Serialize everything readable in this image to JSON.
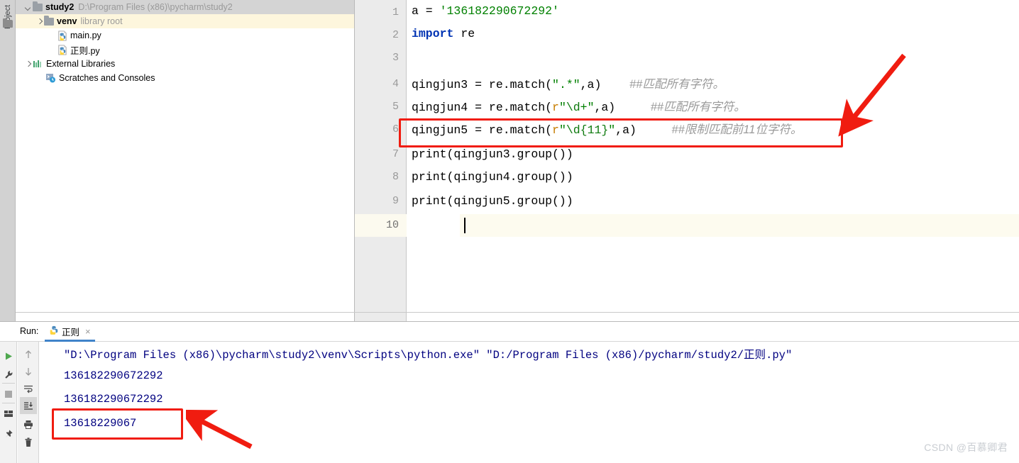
{
  "window": {
    "tool_strip_label": "Project",
    "tool_strip_icon": "folder-icon"
  },
  "project_tree": {
    "items": [
      {
        "name": "study2",
        "detail": "D:\\Program Files (x86)\\pycharm\\study2",
        "icon": "folder-icon",
        "arrow": "chevron-down-icon",
        "indent": 12,
        "state": "selected-grey",
        "bold": true
      },
      {
        "name": "venv",
        "detail": "library root",
        "icon": "folder-icon",
        "arrow": "chevron-right-icon",
        "indent": 28,
        "state": "selected-yellow",
        "bold": true
      },
      {
        "name": "main.py",
        "detail": "",
        "icon": "python-file-icon",
        "arrow": "none",
        "indent": 46,
        "state": "none",
        "bold": false
      },
      {
        "name": "正则.py",
        "detail": "",
        "icon": "python-file-icon",
        "arrow": "none",
        "indent": 46,
        "state": "none",
        "bold": false
      },
      {
        "name": "External Libraries",
        "detail": "",
        "icon": "library-icon",
        "arrow": "chevron-right-icon",
        "indent": 12,
        "state": "none",
        "bold": false
      },
      {
        "name": "Scratches and Consoles",
        "detail": "",
        "icon": "scratches-icon",
        "arrow": "none",
        "indent": 28,
        "state": "none",
        "bold": false
      }
    ]
  },
  "editor": {
    "line_numbers": [
      "1",
      "2",
      "3",
      "4",
      "5",
      "6",
      "7",
      "8",
      "9",
      "10"
    ],
    "active_line": "10",
    "lines": [
      {
        "n": "1",
        "parts": [
          {
            "t": "a = ",
            "c": "plain"
          },
          {
            "t": "'136182290672292'",
            "c": "string"
          }
        ]
      },
      {
        "n": "2",
        "parts": [
          {
            "t": "import",
            "c": "keyword"
          },
          {
            "t": " re",
            "c": "plain"
          }
        ]
      },
      {
        "n": "3",
        "parts": []
      },
      {
        "n": "4",
        "parts": [
          {
            "t": "qingjun3 = re.match(",
            "c": "plain"
          },
          {
            "t": "\".*\"",
            "c": "string"
          },
          {
            "t": ",a)",
            "c": "plain"
          },
          {
            "t": "    ",
            "c": "plain"
          },
          {
            "t": "##匹配所有字符。",
            "c": "comment"
          }
        ]
      },
      {
        "n": "5",
        "parts": [
          {
            "t": "qingjun4 = re.match(",
            "c": "plain"
          },
          {
            "t": "r",
            "c": "prefix"
          },
          {
            "t": "\"",
            "c": "string"
          },
          {
            "t": "\\d",
            "c": "escape"
          },
          {
            "t": "+\"",
            "c": "string"
          },
          {
            "t": ",a)",
            "c": "plain"
          },
          {
            "t": "     ",
            "c": "plain"
          },
          {
            "t": "##匹配所有字符。",
            "c": "comment"
          }
        ]
      },
      {
        "n": "6",
        "parts": [
          {
            "t": "qingjun5 = re.match(",
            "c": "plain"
          },
          {
            "t": "r",
            "c": "prefix"
          },
          {
            "t": "\"",
            "c": "string"
          },
          {
            "t": "\\d{11}",
            "c": "escape"
          },
          {
            "t": "\"",
            "c": "string"
          },
          {
            "t": ",a)",
            "c": "plain"
          },
          {
            "t": "     ",
            "c": "plain"
          },
          {
            "t": "##限制匹配前11位字符。",
            "c": "comment"
          }
        ]
      },
      {
        "n": "7",
        "parts": [
          {
            "t": "print(qingjun3.group())",
            "c": "plain"
          }
        ]
      },
      {
        "n": "8",
        "parts": [
          {
            "t": "print(qingjun4.group())",
            "c": "plain"
          }
        ]
      },
      {
        "n": "9",
        "parts": [
          {
            "t": "print(qingjun5.group())",
            "c": "plain"
          }
        ]
      },
      {
        "n": "10",
        "parts": []
      }
    ],
    "code_plain": {
      "l1": "a = '136182290672292'",
      "l2": "import re",
      "l4": "qingjun3 = re.match(\".*\",a)    ##匹配所有字符。",
      "l5": "qingjun4 = re.match(r\"\\d+\",a)     ##匹配所有字符。",
      "l6": "qingjun5 = re.match(r\"\\d{11}\",a)     ##限制匹配前11位字符。",
      "l7": "print(qingjun3.group())",
      "l8": "print(qingjun4.group())",
      "l9": "print(qingjun5.group())"
    },
    "annotation": {
      "highlight_line": "6",
      "arrow": "red-arrow-pointing-down-left"
    }
  },
  "run_panel": {
    "label": "Run:",
    "tab": {
      "name": "正则",
      "icon": "python-icon",
      "close": "×"
    },
    "left_buttons": [
      {
        "name": "rerun-button",
        "icon": "play-icon"
      },
      {
        "name": "settings-button",
        "icon": "wrench-icon"
      },
      {
        "name": "stop-button",
        "icon": "stop-icon"
      },
      {
        "name": "layout-button",
        "icon": "layout-icon"
      },
      {
        "name": "pin-button",
        "icon": "pin-icon"
      }
    ],
    "right_buttons": [
      {
        "name": "up-button",
        "icon": "arrow-up-icon"
      },
      {
        "name": "down-button",
        "icon": "arrow-down-icon"
      },
      {
        "name": "soft-wrap-button",
        "icon": "soft-wrap-icon"
      },
      {
        "name": "scroll-to-end-button",
        "icon": "scroll-to-end-icon"
      },
      {
        "name": "print-button",
        "icon": "printer-icon"
      },
      {
        "name": "clear-button",
        "icon": "trash-icon"
      }
    ],
    "console_lines": [
      "\"D:\\Program Files (x86)\\pycharm\\study2\\venv\\Scripts\\python.exe\" \"D:/Program Files (x86)/pycharm/study2/正则.py\"",
      "136182290672292",
      "136182290672292",
      "13618229067"
    ],
    "annotation": {
      "highlight_line_index": 3,
      "arrow": "red-arrow-pointing-left"
    }
  },
  "watermark": "CSDN @百慕卿君",
  "colors": {
    "accent_blue": "#4083c9",
    "annotation_red": "#f01c10",
    "string_green": "#008000",
    "keyword_blue": "#0033b3",
    "console_navy": "#000080",
    "comment_grey": "#9a9a9a"
  }
}
